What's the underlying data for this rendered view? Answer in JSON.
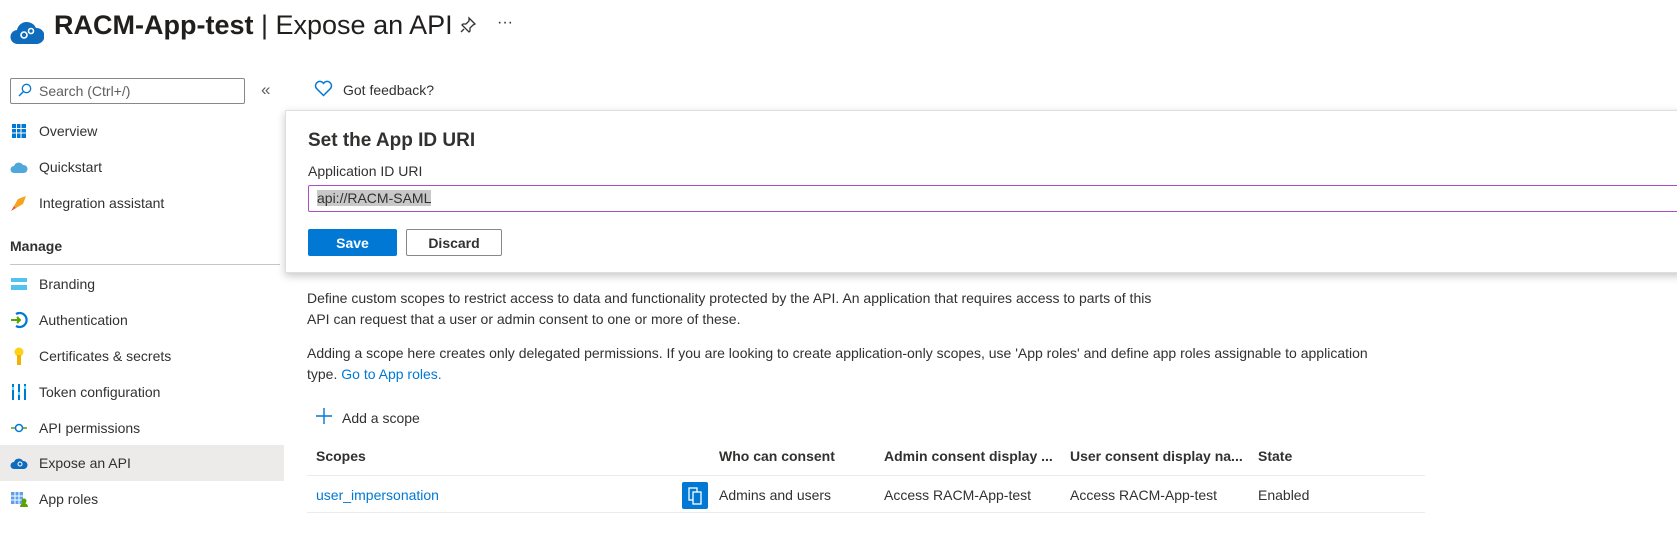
{
  "header": {
    "app_name": "RACM-App-test",
    "separator": "|",
    "page": "Expose an API",
    "pin_icon": "pin-icon",
    "more": "···"
  },
  "sidebar": {
    "search_placeholder": "Search (Ctrl+/)",
    "collapse": "«",
    "items_top": [
      {
        "label": "Overview",
        "icon": "overview-grid-icon"
      },
      {
        "label": "Quickstart",
        "icon": "quickstart-cloud-icon"
      },
      {
        "label": "Integration assistant",
        "icon": "rocket-icon"
      }
    ],
    "manage_heading": "Manage",
    "items_manage": [
      {
        "label": "Branding",
        "icon": "branding-icon"
      },
      {
        "label": "Authentication",
        "icon": "authentication-icon"
      },
      {
        "label": "Certificates & secrets",
        "icon": "key-icon"
      },
      {
        "label": "Token configuration",
        "icon": "token-bars-icon"
      },
      {
        "label": "API permissions",
        "icon": "api-permissions-icon"
      },
      {
        "label": "Expose an API",
        "icon": "expose-api-cloud-icon",
        "active": true
      },
      {
        "label": "App roles",
        "icon": "app-roles-icon"
      }
    ]
  },
  "toolbar": {
    "feedback": "Got feedback?"
  },
  "dialog": {
    "title": "Set the App ID URI",
    "field_label": "Application ID URI",
    "field_value": "api://RACM-SAML",
    "save": "Save",
    "discard": "Discard"
  },
  "main": {
    "para1_line1": "Define custom scopes to restrict access to data and functionality protected by the API. An application that requires access to parts of this",
    "para1_line2": "API can request that a user or admin consent to one or more of these.",
    "para2_line1": "Adding a scope here creates only delegated permissions. If you are looking to create application-only scopes, use 'App roles' and define app roles assignable to application",
    "para2_prefix": "type.",
    "para2_link": "Go to App roles.",
    "add_scope": "Add a scope",
    "table": {
      "headers": [
        "Scopes",
        "Who can consent",
        "Admin consent display ...",
        "User consent display na...",
        "State"
      ],
      "rows": [
        {
          "scope": "user_impersonation",
          "who": "Admins and users",
          "admin": "Access RACM-App-test",
          "user": "Access RACM-App-test",
          "state": "Enabled"
        }
      ]
    }
  },
  "colors": {
    "accent": "#0078d4",
    "input_focus": "#a74fc4",
    "active_nav": "#edebe9"
  }
}
